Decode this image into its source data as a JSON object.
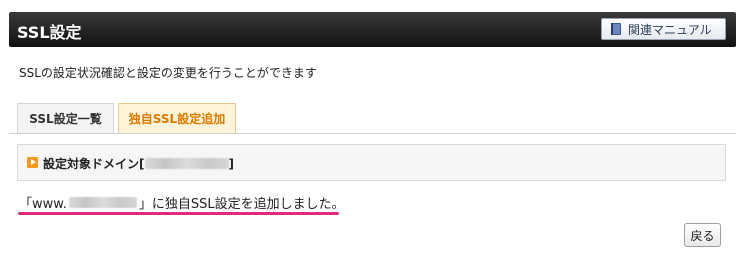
{
  "header": {
    "title": "SSL設定",
    "manual_button": {
      "label": "関連マニュアル",
      "icon": "book-icon"
    }
  },
  "description": "SSLの設定状況確認と設定の変更を行うことができます",
  "tabs": [
    {
      "label": "SSL設定一覧",
      "active": false
    },
    {
      "label": "独自SSL設定追加",
      "active": true
    }
  ],
  "panel": {
    "prefix": "設定対象ドメイン[",
    "suffix": "]"
  },
  "result": {
    "open": "「www.",
    "close": "」に独自SSL設定を追加しました。"
  },
  "back_button": {
    "label": "戻る"
  },
  "colors": {
    "accent_orange": "#e07a00",
    "underline_pink": "#e02a7a",
    "header_bg": "#1a1a1a"
  }
}
